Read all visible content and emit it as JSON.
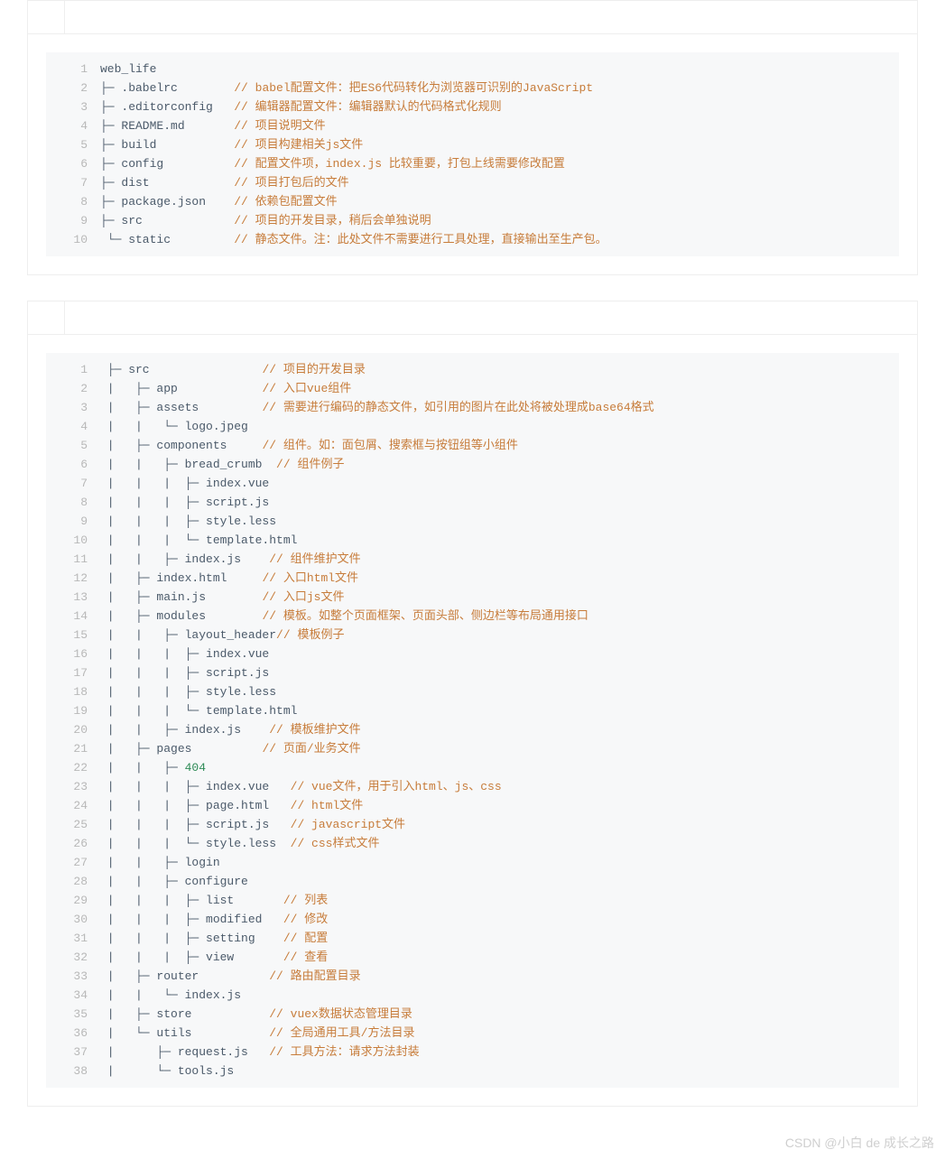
{
  "block1": {
    "lines": [
      {
        "n": "1",
        "tree": "web_life",
        "comment": ""
      },
      {
        "n": "2",
        "tree": "├─ .babelrc        ",
        "comment": "// babel配置文件：把ES6代码转化为浏览器可识别的JavaScript"
      },
      {
        "n": "3",
        "tree": "├─ .editorconfig   ",
        "comment": "// 编辑器配置文件：编辑器默认的代码格式化规则"
      },
      {
        "n": "4",
        "tree": "├─ README.md       ",
        "comment": "// 项目说明文件"
      },
      {
        "n": "5",
        "tree": "├─ build           ",
        "comment": "// 项目构建相关js文件"
      },
      {
        "n": "6",
        "tree": "├─ config          ",
        "comment": "// 配置文件项，index.js 比较重要，打包上线需要修改配置"
      },
      {
        "n": "7",
        "tree": "├─ dist            ",
        "comment": "// 项目打包后的文件"
      },
      {
        "n": "8",
        "tree": "├─ package.json    ",
        "comment": "// 依赖包配置文件"
      },
      {
        "n": "9",
        "tree": "├─ src             ",
        "comment": "// 项目的开发目录，稍后会单独说明"
      },
      {
        "n": "10",
        "tree": " └─ static         ",
        "comment": "// 静态文件。注：此处文件不需要进行工具处理，直接输出至生产包。"
      }
    ]
  },
  "block2": {
    "lines": [
      {
        "n": "1",
        "tree": " ├─ src                ",
        "comment": "// 项目的开发目录"
      },
      {
        "n": "2",
        "tree": " |   ├─ app            ",
        "comment": "// 入口vue组件"
      },
      {
        "n": "3",
        "tree": " |   ├─ assets         ",
        "comment": "// 需要进行编码的静态文件，如引用的图片在此处将被处理成base64格式"
      },
      {
        "n": "4",
        "tree": " |   |   └─ logo.jpeg",
        "comment": ""
      },
      {
        "n": "5",
        "tree": " |   ├─ components     ",
        "comment": "// 组件。如：面包屑、搜索框与按钮组等小组件"
      },
      {
        "n": "6",
        "tree": " |   |   ├─ bread_crumb  ",
        "comment": "// 组件例子"
      },
      {
        "n": "7",
        "tree": " |   |   |  ├─ index.vue",
        "comment": ""
      },
      {
        "n": "8",
        "tree": " |   |   |  ├─ script.js",
        "comment": ""
      },
      {
        "n": "9",
        "tree": " |   |   |  ├─ style.less",
        "comment": ""
      },
      {
        "n": "10",
        "tree": " |   |   |  └─ template.html",
        "comment": ""
      },
      {
        "n": "11",
        "tree": " |   |   ├─ index.js    ",
        "comment": "// 组件维护文件"
      },
      {
        "n": "12",
        "tree": " |   ├─ index.html     ",
        "comment": "// 入口html文件"
      },
      {
        "n": "13",
        "tree": " |   ├─ main.js        ",
        "comment": "// 入口js文件"
      },
      {
        "n": "14",
        "tree": " |   ├─ modules        ",
        "comment": "// 模板。如整个页面框架、页面头部、侧边栏等布局通用接口"
      },
      {
        "n": "15",
        "tree": " |   |   ├─ layout_header",
        "comment": "// 模板例子"
      },
      {
        "n": "16",
        "tree": " |   |   |  ├─ index.vue",
        "comment": ""
      },
      {
        "n": "17",
        "tree": " |   |   |  ├─ script.js",
        "comment": ""
      },
      {
        "n": "18",
        "tree": " |   |   |  ├─ style.less",
        "comment": ""
      },
      {
        "n": "19",
        "tree": " |   |   |  └─ template.html",
        "comment": ""
      },
      {
        "n": "20",
        "tree": " |   |   ├─ index.js    ",
        "comment": "// 模板维护文件"
      },
      {
        "n": "21",
        "tree": " |   ├─ pages          ",
        "comment": "// 页面/业务文件"
      },
      {
        "n": "22",
        "tree": " |   |   ├─ ",
        "g": "404",
        "comment": ""
      },
      {
        "n": "23",
        "tree": " |   |   |  ├─ index.vue   ",
        "comment": "// vue文件，用于引入html、js、css"
      },
      {
        "n": "24",
        "tree": " |   |   |  ├─ page.html   ",
        "comment": "// html文件"
      },
      {
        "n": "25",
        "tree": " |   |   |  ├─ script.js   ",
        "comment": "// javascript文件"
      },
      {
        "n": "26",
        "tree": " |   |   |  └─ style.less  ",
        "comment": "// css样式文件"
      },
      {
        "n": "27",
        "tree": " |   |   ├─ login",
        "comment": ""
      },
      {
        "n": "28",
        "tree": " |   |   ├─ configure",
        "comment": ""
      },
      {
        "n": "29",
        "tree": " |   |   |  ├─ list       ",
        "comment": "// 列表"
      },
      {
        "n": "30",
        "tree": " |   |   |  ├─ modified   ",
        "comment": "// 修改"
      },
      {
        "n": "31",
        "tree": " |   |   |  ├─ setting    ",
        "comment": "// 配置"
      },
      {
        "n": "32",
        "tree": " |   |   |  ├─ view       ",
        "comment": "// 查看"
      },
      {
        "n": "33",
        "tree": " |   ├─ router          ",
        "comment": "// 路由配置目录"
      },
      {
        "n": "34",
        "tree": " |   |   └─ index.js",
        "comment": ""
      },
      {
        "n": "35",
        "tree": " |   ├─ store           ",
        "comment": "// vuex数据状态管理目录"
      },
      {
        "n": "36",
        "tree": " |   └─ utils           ",
        "comment": "// 全局通用工具/方法目录"
      },
      {
        "n": "37",
        "tree": " |      ├─ request.js   ",
        "comment": "// 工具方法：请求方法封装"
      },
      {
        "n": "38",
        "tree": " |      └─ tools.js",
        "comment": ""
      }
    ]
  },
  "watermark": "CSDN @小白 de 成长之路"
}
